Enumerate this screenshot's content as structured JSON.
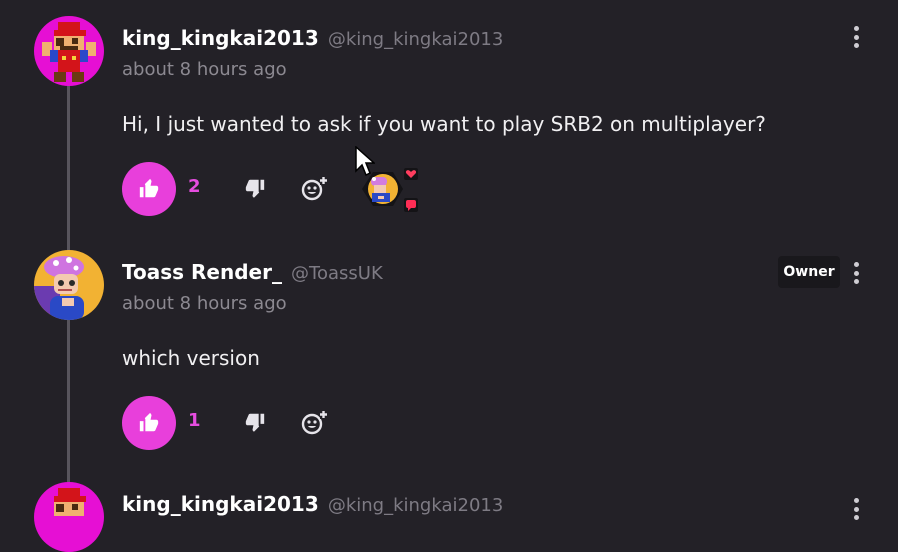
{
  "comments": [
    {
      "author": "king_kingkai2013",
      "handle": "@king_kingkai2013",
      "time": "about 8 hours ago",
      "text": "Hi, I just wanted to ask if you want to play SRB2 on multiplayer?",
      "likes": "2",
      "avatar_icon": "mario-pixel-avatar-icon",
      "reactions": [
        "heart-icon",
        "chat-bubble-icon"
      ]
    },
    {
      "author": "Toass Render_",
      "handle": "@ToassUK",
      "time": "about 8 hours ago",
      "text": "which version",
      "likes": "1",
      "badge": "Owner",
      "avatar_icon": "cartoon-character-avatar-icon"
    },
    {
      "author": "king_kingkai2013",
      "handle": "@king_kingkai2013",
      "avatar_icon": "mario-pixel-avatar-icon"
    }
  ],
  "colors": {
    "background": "#232127",
    "accent": "#e83fdb",
    "thread_line": "#58555d"
  }
}
